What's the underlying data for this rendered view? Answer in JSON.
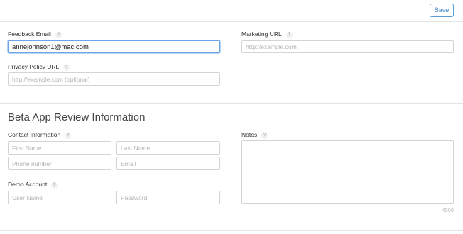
{
  "toolbar": {
    "save_label": "Save"
  },
  "general": {
    "feedback_email": {
      "label": "Feedback Email",
      "value": "annejohnson1@mac.com"
    },
    "marketing_url": {
      "label": "Marketing URL",
      "placeholder": "http://example.com"
    },
    "privacy_url": {
      "label": "Privacy Policy URL",
      "placeholder": "http://example.com (optional)"
    }
  },
  "beta": {
    "title": "Beta App Review Information",
    "contact_label": "Contact Information",
    "first_name_placeholder": "First Name",
    "last_name_placeholder": "Last Name",
    "phone_placeholder": "Phone number",
    "email_placeholder": "Email",
    "demo_label": "Demo Account",
    "username_placeholder": "User Name",
    "password_placeholder": "Password",
    "notes_label": "Notes",
    "notes_counter": "4000"
  },
  "help_glyph": "?"
}
